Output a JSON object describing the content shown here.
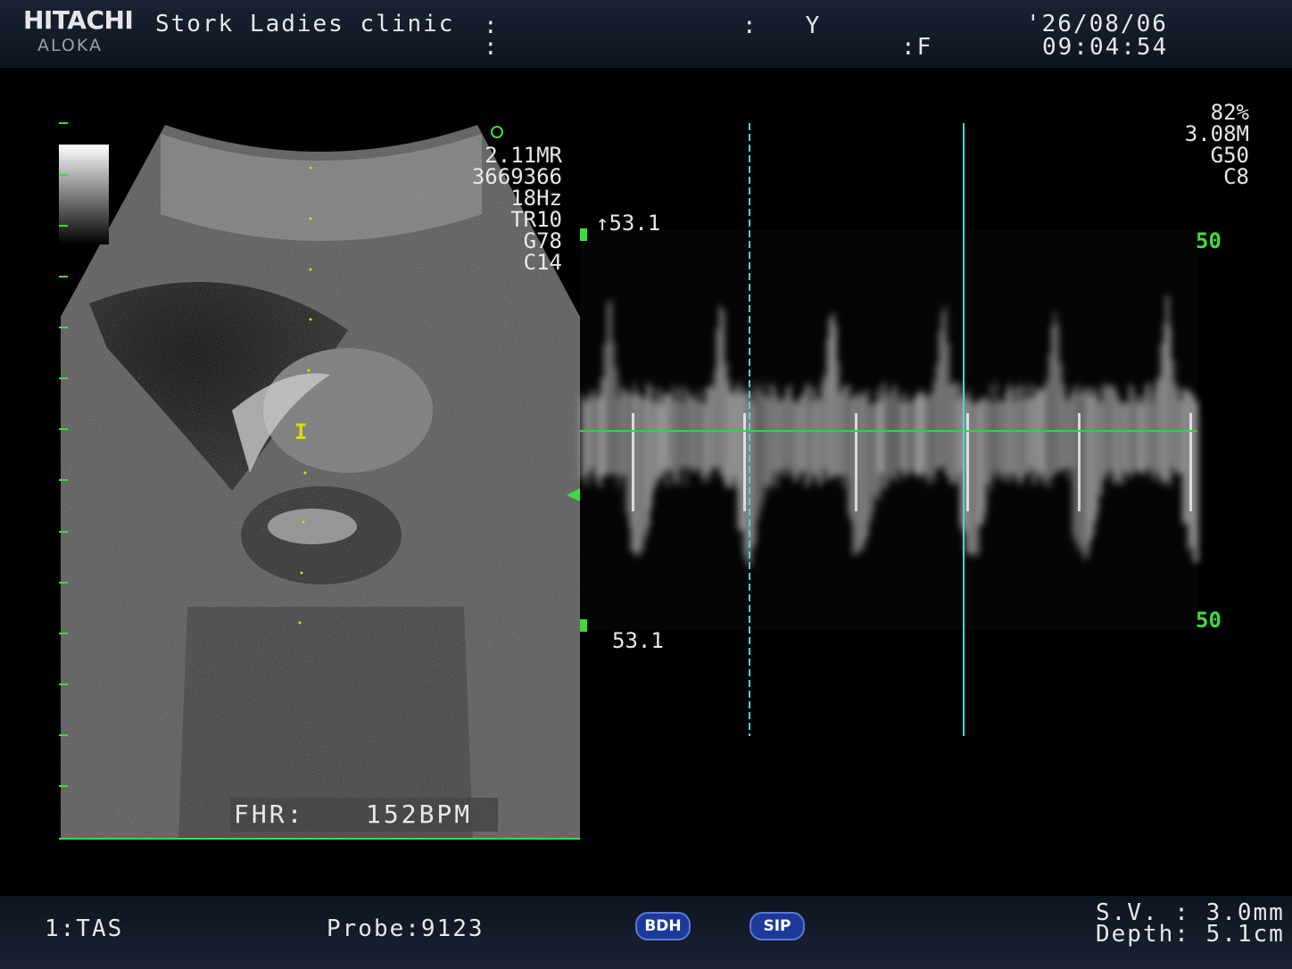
{
  "header": {
    "brand": "HITACHI",
    "sub_brand": "ALOKA",
    "clinic": "Stork Ladies clinic",
    "colon1": ":",
    "colon2": ":",
    "field_y": ":   Y",
    "field_f": ":F",
    "date": "'26/08/06",
    "time": "09:04:54"
  },
  "bmode": {
    "params": [
      "2.11MR",
      "3669366",
      "18Hz",
      "TR10",
      "G78",
      "C14"
    ],
    "fhr_label": "FHR:",
    "fhr_value": "152BPM",
    "gate_marker": "I"
  },
  "doppler": {
    "params": [
      "82%",
      "3.08M",
      "G50",
      "C8"
    ],
    "top_velocity": "↑53.1",
    "bottom_velocity": "53.1",
    "scale_top": "50",
    "scale_bottom": "50",
    "baseline_color": "#22e022",
    "cursor_color": "#4fd0e0"
  },
  "footer": {
    "mode": "1:TAS",
    "probe": "Probe:9123",
    "btn_bdh": "BDH",
    "btn_sip": "SIP",
    "sv": "S.V. : 3.0mm",
    "depth": "Depth: 5.1cm"
  }
}
